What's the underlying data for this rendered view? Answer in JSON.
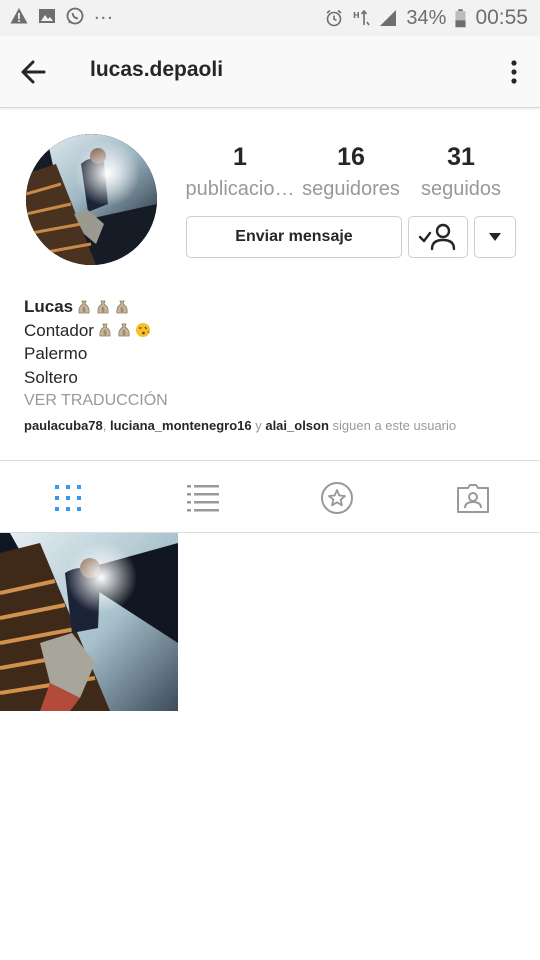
{
  "status_bar": {
    "left_icons": [
      "warning-icon",
      "gallery-icon",
      "whatsapp-icon"
    ],
    "more": "...",
    "battery_percent": "34%",
    "time": "00:55"
  },
  "app_bar": {
    "title": "lucas.depaoli",
    "back_icon": "arrow-left-icon",
    "menu_icon": "more-vertical-icon"
  },
  "profile": {
    "stats": [
      {
        "count": "1",
        "label": "publicacio…"
      },
      {
        "count": "16",
        "label": "seguidores"
      },
      {
        "count": "31",
        "label": "seguidos"
      }
    ],
    "message_button": "Enviar mensaje",
    "bio": {
      "name": "Lucas",
      "lines": [
        "Contador",
        "Palermo",
        "Soltero"
      ],
      "translate": "VER TRADUCCIÓN"
    },
    "followed_by": {
      "user1": "paulacuba78",
      "sep1": ", ",
      "user2": "luciana_montenegro16",
      "and": " y ",
      "user3": "alai_olson",
      "suffix": " siguen a este usuario"
    }
  },
  "tabs": [
    "grid-icon",
    "list-icon",
    "star-icon",
    "tagged-icon"
  ],
  "colors": {
    "active_tab": "#3897f0",
    "inactive_icon": "#999999",
    "text": "#262626",
    "secondary_text": "#999999"
  }
}
